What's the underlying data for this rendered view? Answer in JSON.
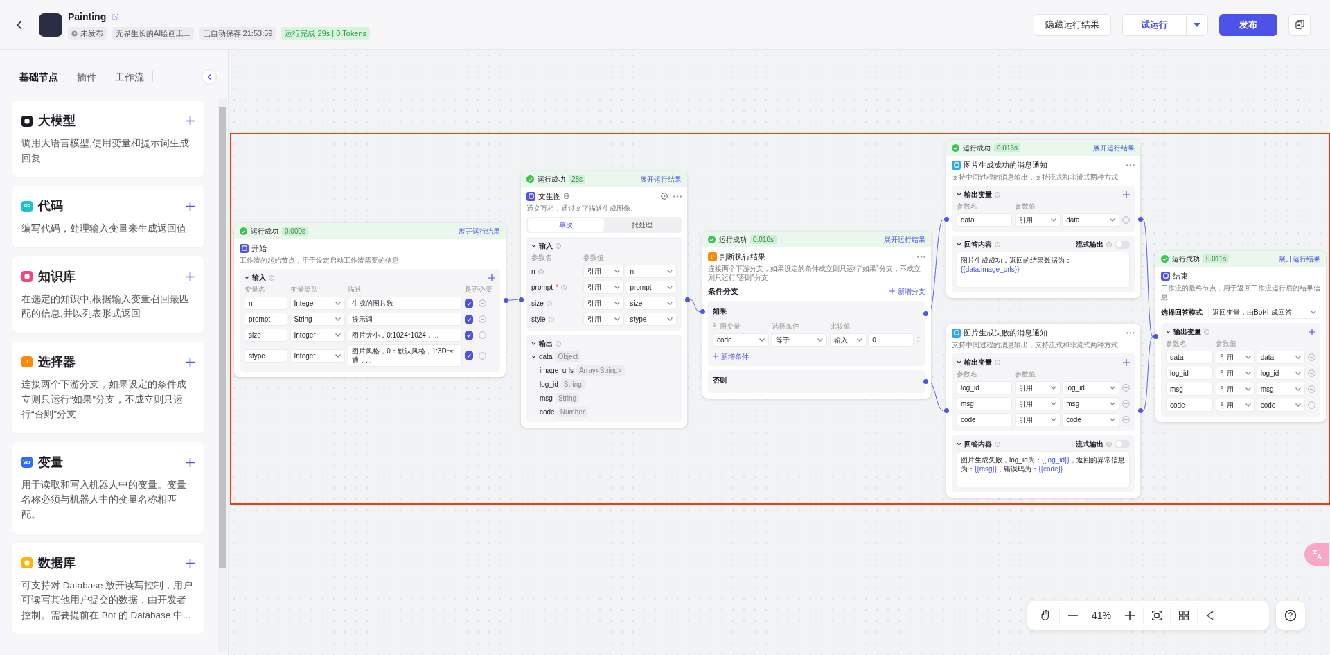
{
  "header": {
    "title": "Painting",
    "publish_status": "未发布",
    "bot_name": "无界生长的AI绘画工...",
    "autosave": "已自动保存 21:53:59",
    "run_result": "运行完成 29s | 0 Tokens",
    "buttons": [
      {
        "kind": "plain",
        "label": "隐藏运行结果"
      },
      {
        "kind": "split",
        "label": "试运行"
      },
      {
        "kind": "primary",
        "label": "发布"
      }
    ]
  },
  "sidebar": {
    "tabs": [
      {
        "label": "基础节点",
        "selected": true
      },
      {
        "label": "插件",
        "selected": false
      },
      {
        "label": "工作流",
        "selected": false
      }
    ],
    "cards": [
      {
        "title": "大模型",
        "description": "调用大语言模型,使用变量和提示词生成回复",
        "color": "#1d1c23"
      },
      {
        "title": "代码",
        "description": "编写代码，处理输入变量来生成返回值",
        "color": "#1fc1c8",
        "icon_label": "</>"
      },
      {
        "title": "知识库",
        "description": "在选定的知识中,根据输入变量召回最匹配的信息,并以列表形式返回",
        "color": "#f0477d"
      },
      {
        "title": "选择器",
        "description": "连接两个下游分支，如果设定的条件成立则只运行“如果”分支，不成立则只运行“否则”分支",
        "color": "#ff8a00",
        "icon_label": "If"
      },
      {
        "title": "变量",
        "description": "用于读取和写入机器人中的变量。变量名称必须与机器人中的变量名称相匹配。",
        "color": "#2e6df6",
        "icon_label": "Var"
      },
      {
        "title": "数据库",
        "description": "可支持对 Database 放开读写控制，用户可读写其他用户提交的数据，由开发者控制。需要提前在 Bot 的 Database 中...",
        "color": "#ffb400"
      }
    ]
  },
  "canvas": {
    "nodes": [
      {
        "kind": "start",
        "status": {
          "label": "运行成功",
          "time": "0.000s",
          "link": "展开运行结果"
        },
        "title": "开始",
        "description": "工作流的起始节点，用于设定启动工作流需要的信息",
        "color": "#4d53e8",
        "inputs": {
          "title": "输入",
          "columns": [
            "变量名",
            "变量类型",
            "描述",
            "是否必要"
          ],
          "rows": [
            {
              "name": "n",
              "type": "Integer",
              "description": "生成的图片数",
              "required": true
            },
            {
              "name": "prompt",
              "type": "String",
              "description": "提示词",
              "required": true
            },
            {
              "name": "size",
              "type": "Integer",
              "description": "图片大小，0:1024*1024，...",
              "required": true
            },
            {
              "name": "stype",
              "type": "Integer",
              "description": "图片风格，0：默认风格，1:3D卡通，...",
              "required": true
            }
          ]
        }
      },
      {
        "kind": "text_to_image",
        "status": {
          "label": "运行成功",
          "time": "28s",
          "link": "展开运行结果"
        },
        "title": "文生图",
        "description": "通义万相，通过文字描述生成图像。",
        "color": "#4d53e8",
        "mode_tabs": [
          {
            "label": "单次",
            "selected": true
          },
          {
            "label": "批处理",
            "selected": false
          }
        ],
        "inputs": {
          "title": "输入",
          "columns": [
            "参数名",
            "参数值"
          ],
          "rows": [
            {
              "name": "n",
              "source": "引用",
              "value": "n"
            },
            {
              "name": "prompt",
              "required_mark": "*",
              "source": "引用",
              "value": "prompt"
            },
            {
              "name": "size",
              "source": "引用",
              "value": "size"
            },
            {
              "name": "style",
              "source": "引用",
              "value": "stype"
            }
          ]
        },
        "outputs": {
          "title": "输出",
          "items": [
            {
              "name": "data",
              "type": "Object",
              "expanded": true,
              "children": [
                {
                  "name": "image_urls",
                  "type": "Array<String>"
                },
                {
                  "name": "log_id",
                  "type": "String"
                },
                {
                  "name": "msg",
                  "type": "String"
                },
                {
                  "name": "code",
                  "type": "Number"
                }
              ]
            }
          ]
        }
      },
      {
        "kind": "condition",
        "status": {
          "label": "运行成功",
          "time": "0.010s",
          "link": "展开运行结果"
        },
        "title": "判断执行结果",
        "description": "连接两个下游分支，如果设定的条件成立则只运行“如果”分支，不成立则只运行“否则”分支",
        "color": "#ff8a00",
        "icon_label": "If",
        "branches_title": "条件分支",
        "add_branch": "新增分支",
        "branches": [
          {
            "label": "如果",
            "columns": [
              "引用变量",
              "选择条件",
              "比较值"
            ],
            "conditions": [
              {
                "left": "code",
                "operator": "等于",
                "source": "输入",
                "value": "0"
              }
            ],
            "add_condition": "新增条件"
          },
          {
            "label": "否则"
          }
        ]
      },
      {
        "kind": "message",
        "status": {
          "label": "运行成功",
          "time": "0.016s",
          "link": "展开运行结果"
        },
        "title": "图片生成成功的消息通知",
        "description": "支持中间过程的消息输出，支持流式和非流式两种方式",
        "color": "#2aa6f5",
        "outputs": {
          "title": "输出变量",
          "columns": [
            "参数名",
            "参数值"
          ],
          "rows": [
            {
              "name": "data",
              "source": "引用",
              "value": "data"
            }
          ]
        },
        "answer": {
          "title": "回答内容",
          "stream_label": "流式输出",
          "stream": false,
          "content": [
            {
              "kind": "text",
              "text": "图片生成成功，返回的结果数据为："
            },
            {
              "kind": "var",
              "text": "{{data.image_urls}}"
            }
          ]
        }
      },
      {
        "kind": "message",
        "title": "图片生成失败的消息通知",
        "description": "支持中间过程的消息输出，支持流式和非流式两种方式",
        "color": "#2aa6f5",
        "outputs": {
          "title": "输出变量",
          "columns": [
            "参数名",
            "参数值"
          ],
          "rows": [
            {
              "name": "log_id",
              "source": "引用",
              "value": "log_id"
            },
            {
              "name": "msg",
              "source": "引用",
              "value": "msg"
            },
            {
              "name": "code",
              "source": "引用",
              "value": "code"
            }
          ]
        },
        "answer": {
          "title": "回答内容",
          "stream_label": "流式输出",
          "stream": false,
          "content": [
            {
              "kind": "text",
              "text": "图片生成失败，log_id为："
            },
            {
              "kind": "var",
              "text": "{{log_id}}"
            },
            {
              "kind": "text",
              "text": "，返回的异常信息为："
            },
            {
              "kind": "var",
              "text": "{{msg}}"
            },
            {
              "kind": "text",
              "text": "，错误码为："
            },
            {
              "kind": "var",
              "text": "{{code}}"
            }
          ]
        }
      },
      {
        "kind": "end",
        "status": {
          "label": "运行成功",
          "time": "0.011s",
          "link": "展开运行结果"
        },
        "title": "结束",
        "description": "工作流的最终节点，用于返回工作流运行后的结果信息",
        "color": "#4d53e8",
        "answer_mode": {
          "label": "选择回答模式",
          "value": "返回变量，由Bot生成回答"
        },
        "outputs": {
          "title": "输出变量",
          "columns": [
            "参数名",
            "参数值"
          ],
          "rows": [
            {
              "name": "data",
              "source": "引用",
              "value": "data"
            },
            {
              "name": "log_id",
              "source": "引用",
              "value": "log_id"
            },
            {
              "name": "msg",
              "source": "引用",
              "value": "msg"
            },
            {
              "name": "code",
              "source": "引用",
              "value": "code"
            }
          ]
        }
      }
    ]
  },
  "zoom_toolbar": {
    "zoom": "41%"
  }
}
